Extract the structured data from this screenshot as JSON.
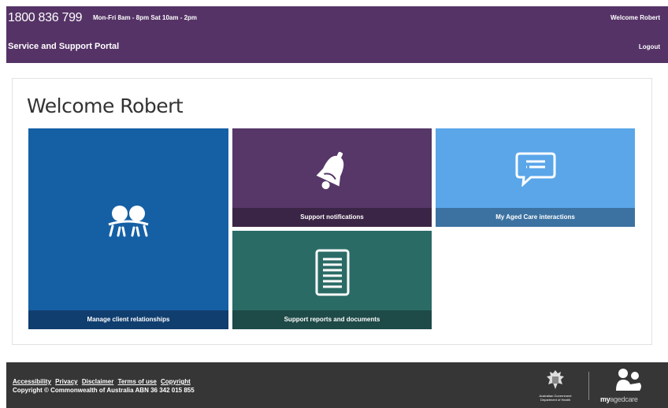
{
  "header": {
    "phone": "1800 836 799",
    "hours": "Mon-Fri 8am - 8pm Sat 10am - 2pm",
    "welcome": "Welcome Robert",
    "portal_title": "Service and Support Portal",
    "logout_label": "Logout"
  },
  "main": {
    "title": "Welcome Robert",
    "tiles": [
      {
        "label": "Manage client relationships",
        "icon": "people-icon",
        "color": "#1560a5"
      },
      {
        "label": "Support notifications",
        "icon": "bell-icon",
        "color": "#563768"
      },
      {
        "label": "My Aged Care interactions",
        "icon": "chat-icon",
        "color": "#5aa6e9"
      },
      {
        "label": "Support reports and documents",
        "icon": "document-icon",
        "color": "#2b6b66"
      }
    ]
  },
  "footer": {
    "links": [
      "Accessibility",
      "Privacy",
      "Disclaimer",
      "Terms of use",
      "Copyright"
    ],
    "copyright": "Copyright © Commonwealth of Australia ABN 36 342 015 855",
    "gov_logo_text": [
      "Australian Government",
      "Department of Health"
    ],
    "brand": {
      "my": "my",
      "aged": "aged",
      "care": "care"
    }
  },
  "colors": {
    "header_bg": "#553366",
    "footer_bg": "#363636"
  }
}
